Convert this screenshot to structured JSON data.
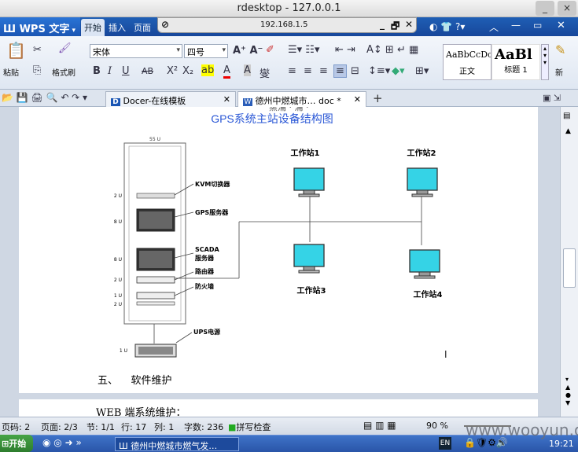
{
  "window": {
    "title": "rdesktop - 127.0.0.1",
    "minimize": "_",
    "close": "×"
  },
  "app": {
    "name": "WPS 文字"
  },
  "menu": [
    "开始",
    "插入",
    "页面"
  ],
  "rdesktop_bar": {
    "ip": "192.168.1.5",
    "min": "_",
    "restore": "🗗",
    "close": "✕"
  },
  "ribbon": {
    "paste": "粘贴",
    "format_painter": "格式刷",
    "font_name": "宋体",
    "font_size": "四号",
    "styles": [
      {
        "preview": "AaBbCcDc",
        "label": "正文"
      },
      {
        "preview": "AaBl",
        "label": "标题 1"
      }
    ],
    "new_style": "新"
  },
  "tabs": [
    {
      "label": "Docer-在线模板"
    },
    {
      "label": "德州中燃城市… doc *"
    }
  ],
  "document": {
    "diagram_title": "GPS系统主站设备结构图",
    "rack_top": "55 U",
    "rack_units": [
      "2 U",
      "8 U",
      "8 U",
      "2 U",
      "1 U",
      "2 U"
    ],
    "rack_labels": [
      "KVM切换器",
      "GPS服务器",
      "SCADA\n服务器",
      "路由器",
      "防火墙"
    ],
    "ups_unit": "1 U",
    "ups_label": "UPS电源",
    "workstations": [
      "工作站1",
      "工作站2",
      "工作站3",
      "工作站4"
    ],
    "section_heading": "五、    软件维护",
    "next_text": "WEB 端系统维护："
  },
  "statusbar": {
    "page_code": "页码: 2",
    "pages": "页面: 2/3",
    "section": "节: 1/1",
    "row": "行: 17",
    "col": "列: 1",
    "chars": "字数: 236",
    "spell": "拼写检查",
    "zoom": "90 %"
  },
  "taskbar": {
    "start": "开始",
    "task": "德州中燃城市燃气发…",
    "clock": "19:21"
  },
  "watermark": "www.wooyun.org",
  "colors": {
    "accent": "#1b56b4",
    "monitor": "#35d3e6",
    "title_blue": "#2b58d6"
  }
}
